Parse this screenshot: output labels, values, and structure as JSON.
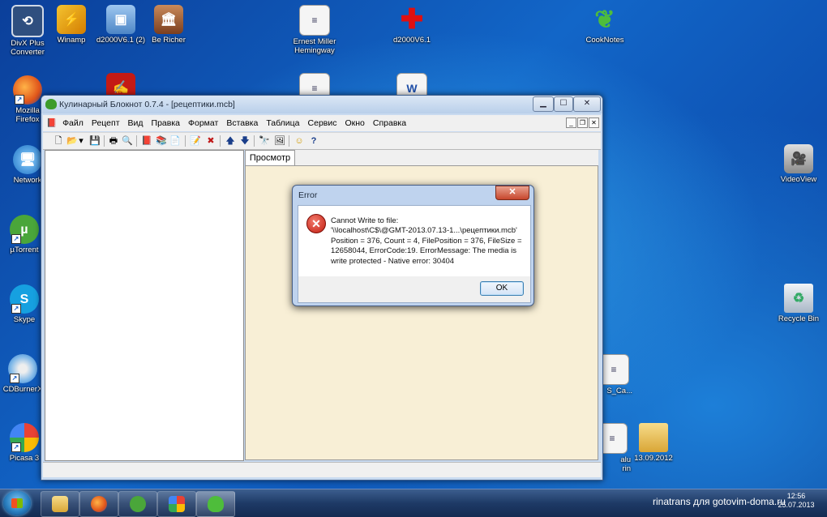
{
  "desktop": {
    "icons": [
      {
        "label": "DivX Plus\nConverter",
        "icon": "divx-icon"
      },
      {
        "label": "Winamp",
        "icon": "winamp-icon"
      },
      {
        "label": "d2000V6.1 (2)",
        "icon": "install-icon"
      },
      {
        "label": "Be Richer",
        "icon": "building-icon"
      },
      {
        "label": "Ernest Miller\nHemingway",
        "icon": "document-icon"
      },
      {
        "label": "d2000V6.1",
        "icon": "red-cross-icon"
      },
      {
        "label": "CookNotes",
        "icon": "leaf-icon"
      },
      {
        "label": "Mozilla\nFirefox",
        "icon": "firefox-icon"
      },
      {
        "label": "Network",
        "icon": "network-icon"
      },
      {
        "label": "µTorrent",
        "icon": "utorrent-icon"
      },
      {
        "label": "Skype",
        "icon": "skype-icon"
      },
      {
        "label": "CDBurnerX",
        "icon": "cd-icon"
      },
      {
        "label": "Picasa 3",
        "icon": "picasa-icon"
      },
      {
        "label": "VideoView",
        "icon": "camera-icon"
      },
      {
        "label": "Recycle Bin",
        "icon": "recycle-bin-icon"
      },
      {
        "label": "S_Ca...",
        "icon": "document-icon"
      },
      {
        "label": "alu\nrin",
        "icon": "document-icon"
      },
      {
        "label": "13.09.2012",
        "icon": "folder-icon"
      }
    ]
  },
  "app": {
    "title": "Кулинарный Блокнот 0.7.4 - [рецептики.mcb]",
    "caption_buttons": {
      "minimize": "▁",
      "maximize": "☐",
      "close": "✕"
    },
    "menu": [
      "Файл",
      "Рецепт",
      "Вид",
      "Правка",
      "Формат",
      "Вставка",
      "Таблица",
      "Сервис",
      "Окно",
      "Справка"
    ],
    "mdi_buttons": {
      "minimize": "_",
      "restore": "❐",
      "close": "✕"
    },
    "toolbar": [
      {
        "name": "new-icon",
        "glyph": "🗋"
      },
      {
        "name": "open-icon",
        "glyph": "📂"
      },
      {
        "name": "dropdown-arrow-icon",
        "glyph": "▾"
      },
      {
        "name": "save-icon",
        "glyph": "💾"
      },
      {
        "name": "print-icon",
        "glyph": "🖶"
      },
      {
        "name": "print-preview-icon",
        "glyph": "🔍"
      },
      {
        "name": "book-icon",
        "glyph": "📕"
      },
      {
        "name": "books-icon",
        "glyph": "📚"
      },
      {
        "name": "page-icon",
        "glyph": "📄"
      },
      {
        "name": "edit-icon",
        "glyph": "📝"
      },
      {
        "name": "delete-icon",
        "glyph": "✖"
      },
      {
        "name": "arrow-up-icon",
        "glyph": "🡅"
      },
      {
        "name": "arrow-down-icon",
        "glyph": "🡇"
      },
      {
        "name": "find-icon",
        "glyph": "🔭"
      },
      {
        "name": "image-icon",
        "glyph": "🖼"
      },
      {
        "name": "smiley-icon",
        "glyph": "☺"
      },
      {
        "name": "help-icon",
        "glyph": "?"
      }
    ],
    "tab_label": "Просмотр"
  },
  "dialog": {
    "title": "Error",
    "close_glyph": "✕",
    "icon_glyph": "✕",
    "message_lines": [
      "Cannot Write to file:",
      "'\\\\localhost\\C$\\@GMT-2013.07.13-1...\\рецептики.mcb'",
      "Position = 376, Count = 4, FilePosition = 376, FileSize =",
      "12658044, ErrorCode:19. ErrorMessage: The media is",
      "write protected - Native error: 30404"
    ],
    "ok_label": "OK"
  },
  "taskbar": {
    "tray_text": "rinatrans для gotovim-doma.ru",
    "time": "12:56",
    "date": "25.07.2013"
  }
}
